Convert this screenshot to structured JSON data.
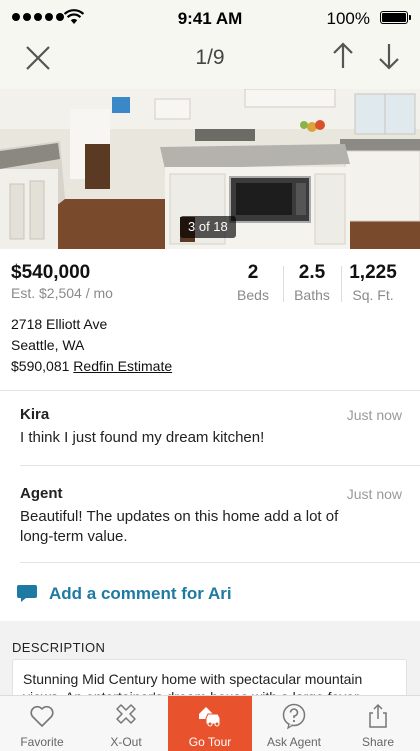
{
  "status_bar": {
    "time": "9:41 AM",
    "battery": "100%"
  },
  "nav": {
    "counter": "1/9"
  },
  "photo": {
    "badge": "3 of 18"
  },
  "listing": {
    "price": "$540,000",
    "monthly_estimate": "Est. $2,504 / mo",
    "beds": {
      "value": "2",
      "label": "Beds"
    },
    "baths": {
      "value": "2.5",
      "label": "Baths"
    },
    "sqft": {
      "value": "1,225",
      "label": "Sq. Ft."
    },
    "address_line1": "2718 Elliott Ave",
    "address_line2": "Seattle, WA",
    "estimate_value": "$590,081",
    "estimate_link": "Redfin Estimate"
  },
  "comments": [
    {
      "author": "Kira",
      "time": "Just now",
      "text": "I think I just found my dream kitchen!"
    },
    {
      "author": "Agent",
      "time": "Just now",
      "text": "Beautiful! The updates on this home add a lot of long-term value."
    }
  ],
  "add_comment_label": "Add a comment for Ari",
  "description": {
    "title": "DESCRIPTION",
    "text": "Stunning Mid Century home with spectacular mountain views. An entertainer's dream house with a large foyer."
  },
  "tabs": [
    {
      "label": "Favorite",
      "icon": "heart-icon"
    },
    {
      "label": "X-Out",
      "icon": "x-icon"
    },
    {
      "label": "Go Tour",
      "icon": "car-icon"
    },
    {
      "label": "Ask Agent",
      "icon": "question-icon"
    },
    {
      "label": "Share",
      "icon": "share-icon"
    }
  ],
  "colors": {
    "accent": "#e8522d",
    "link": "#1f7aa3"
  }
}
